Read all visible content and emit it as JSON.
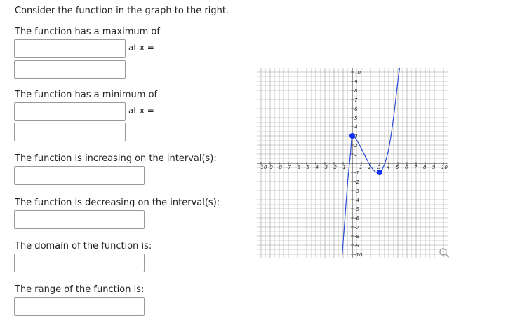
{
  "intro": "Consider the function in the graph to the right.",
  "max": {
    "label": "The function has a maximum of",
    "at_label": "at x =",
    "value": "",
    "x_value": ""
  },
  "min": {
    "label": "The function has a minimum of",
    "at_label": "at x =",
    "value": "",
    "x_value": ""
  },
  "increasing": {
    "label": "The function is increasing on the interval(s):",
    "value": ""
  },
  "decreasing": {
    "label": "The function is decreasing on the interval(s):",
    "value": ""
  },
  "domain": {
    "label": "The domain of the function is:",
    "value": ""
  },
  "range": {
    "label": "The range of the function is:",
    "value": ""
  },
  "chart_data": {
    "type": "line",
    "xlim": [
      -10,
      10
    ],
    "ylim": [
      -10,
      10
    ],
    "grid": true,
    "x_ticks": [
      "-10",
      "-9",
      "-8",
      "-7",
      "-6",
      "-5",
      "-4",
      "-3",
      "-2",
      "-1",
      "1",
      "2",
      "3",
      "4",
      "5",
      "6",
      "7",
      "8",
      "9",
      "10"
    ],
    "y_ticks": [
      "10",
      "9",
      "8",
      "7",
      "6",
      "5",
      "4",
      "3",
      "2",
      "1",
      "-1",
      "-2",
      "-3",
      "-4",
      "-5",
      "-6",
      "-7",
      "-8",
      "-9",
      "-10"
    ],
    "curve": {
      "color": "#2a4bd8",
      "points": [
        [
          -1.1,
          -10
        ],
        [
          -0.8,
          -6
        ],
        [
          -0.5,
          -2
        ],
        [
          -0.2,
          1
        ],
        [
          0,
          3
        ],
        [
          0.5,
          2.5
        ],
        [
          1,
          1.6
        ],
        [
          1.5,
          0.6
        ],
        [
          2,
          -0.3
        ],
        [
          2.5,
          -0.9
        ],
        [
          3,
          -1
        ],
        [
          3.5,
          -0.2
        ],
        [
          4,
          1.6
        ],
        [
          4.5,
          4.8
        ],
        [
          5,
          9
        ],
        [
          5.2,
          10.5
        ]
      ]
    },
    "highlighted_points": [
      {
        "x": 0,
        "y": 3
      },
      {
        "x": 3,
        "y": -1
      }
    ],
    "highlight_color": "#1030f0"
  }
}
